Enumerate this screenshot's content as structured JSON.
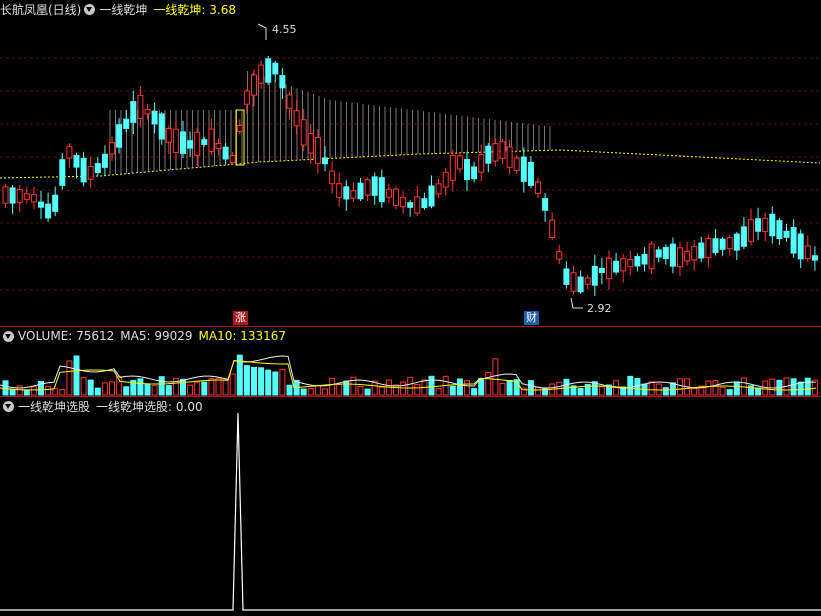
{
  "main_panel": {
    "title": "长航凤凰(日线)",
    "indicator_name": "一线乾坤",
    "indicator_value_label": "一线乾坤: 3.68",
    "high_label": "4.55",
    "low_label": "2.92",
    "marker_zhang": "涨",
    "marker_cai": "财"
  },
  "volume_panel": {
    "volume_label": "VOLUME: 75612",
    "ma5_label": "MA5: 99029",
    "ma10_label": "MA10: 133167"
  },
  "signal_panel": {
    "title": "一线乾坤选股",
    "value_label": "一线乾坤选股: 0.00"
  },
  "colors": {
    "up": "#ff3333",
    "down": "#54ffff",
    "highlight": "#ffff00",
    "separator": "#b01818",
    "text": "#cccccc"
  },
  "icons": [
    "chevron-down-icon"
  ],
  "chart_data": {
    "type": "candlestick",
    "price_high": 4.55,
    "price_low": 2.92,
    "indicator_value": 3.68,
    "volume_latest": 75612,
    "ma5_latest": 99029,
    "ma10_latest": 133167,
    "signal_latest": 0.0
  }
}
